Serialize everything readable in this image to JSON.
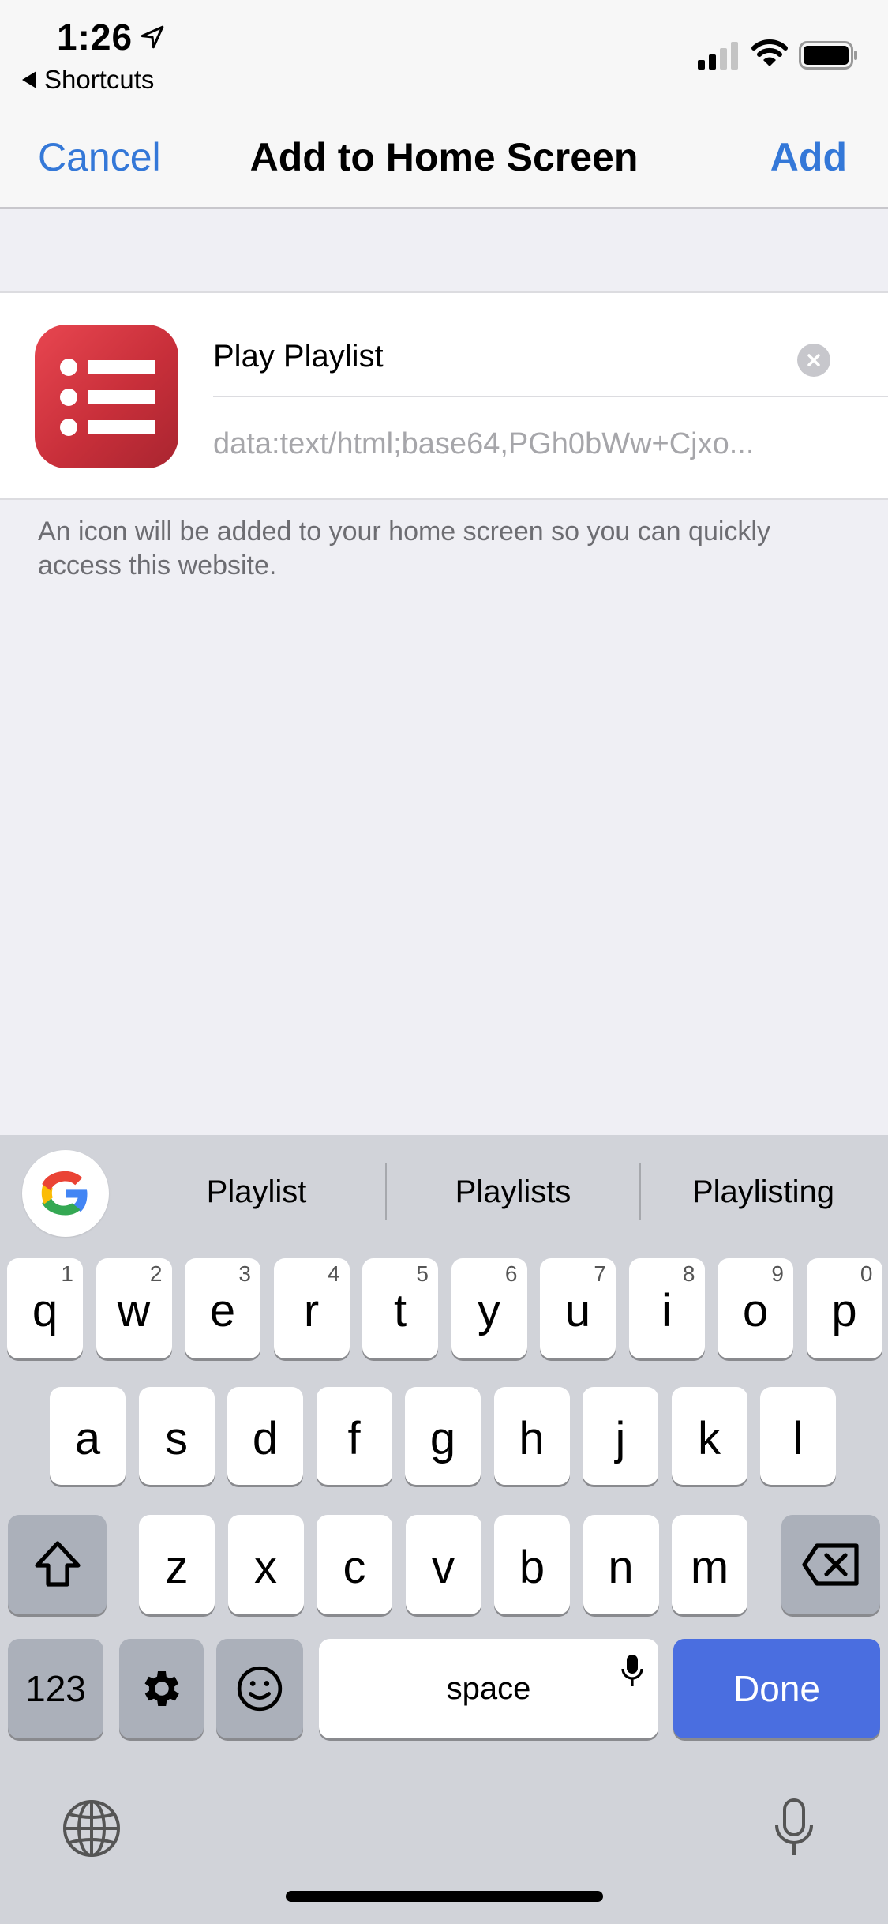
{
  "status_bar": {
    "time": "1:26",
    "back_app_label": "Shortcuts",
    "location_icon": "location-arrow-icon",
    "signal_icon": "cellular-signal-icon",
    "wifi_icon": "wifi-icon",
    "battery_icon": "battery-icon"
  },
  "nav": {
    "cancel_label": "Cancel",
    "title": "Add to Home Screen",
    "add_label": "Add",
    "accent_color": "#3478d8"
  },
  "shortcut": {
    "icon": "list-icon",
    "icon_color": "#d93a44",
    "name_value": "Play Playlist",
    "url": "data:text/html;base64,PGh0bWw+Cjxo...",
    "clear_icon": "clear-text-icon"
  },
  "footer_note": "An icon will be added to your home screen so you can quickly access this website.",
  "keyboard": {
    "google_icon": "google-g-icon",
    "suggestions": [
      "Playlist",
      "Playlists",
      "Playlisting"
    ],
    "row1": [
      {
        "letter": "q",
        "num": "1"
      },
      {
        "letter": "w",
        "num": "2"
      },
      {
        "letter": "e",
        "num": "3"
      },
      {
        "letter": "r",
        "num": "4"
      },
      {
        "letter": "t",
        "num": "5"
      },
      {
        "letter": "y",
        "num": "6"
      },
      {
        "letter": "u",
        "num": "7"
      },
      {
        "letter": "i",
        "num": "8"
      },
      {
        "letter": "o",
        "num": "9"
      },
      {
        "letter": "p",
        "num": "0"
      }
    ],
    "row2": [
      "a",
      "s",
      "d",
      "f",
      "g",
      "h",
      "j",
      "k",
      "l"
    ],
    "row3": [
      "z",
      "x",
      "c",
      "v",
      "b",
      "n",
      "m"
    ],
    "shift_icon": "shift-icon",
    "delete_icon": "backspace-icon",
    "numbers_label": "123",
    "settings_icon": "gear-icon",
    "emoji_icon": "emoji-icon",
    "space_label": "space",
    "space_mic_icon": "microphone-icon",
    "done_label": "Done",
    "done_color": "#4a6ee0",
    "globe_icon": "globe-icon",
    "dictation_icon": "microphone-icon"
  }
}
